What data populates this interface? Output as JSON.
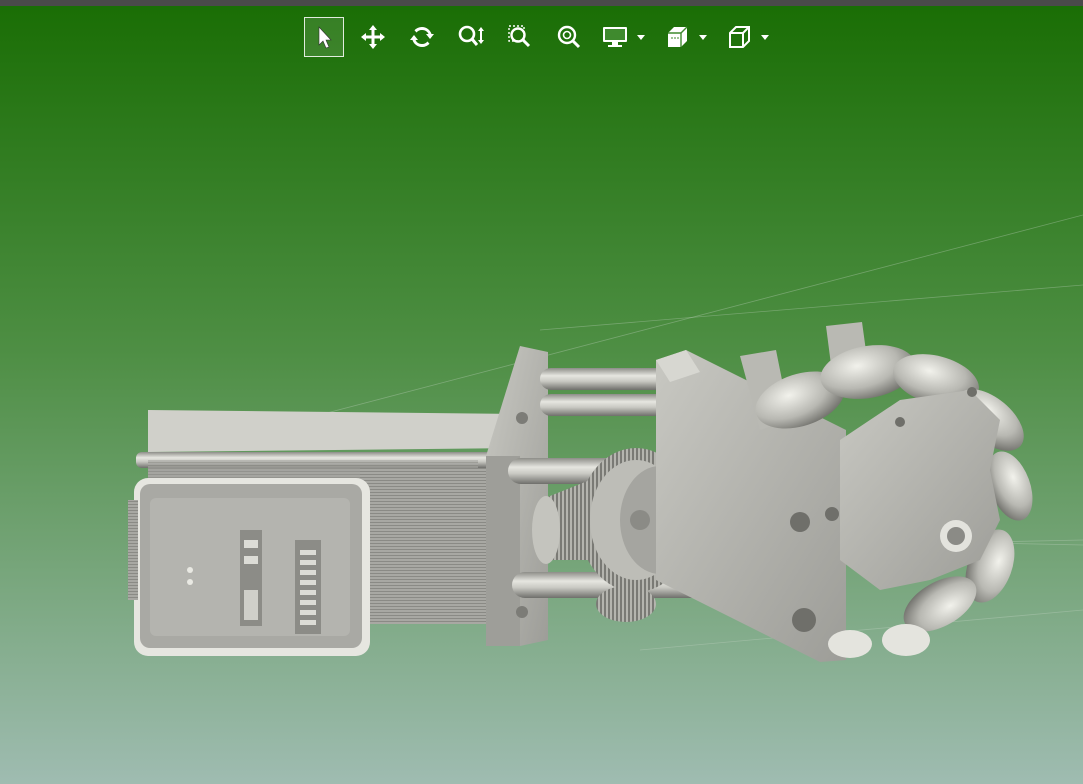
{
  "viewer": {
    "background_top": "#1a6e05",
    "background_bottom": "#9fbcb1",
    "top_strip": "#4a4a4a",
    "icon_color": "#ffffff",
    "part_color": "#b9b9b4"
  },
  "toolbar": {
    "tools": [
      {
        "name": "select-tool",
        "icon": "pointer-arrow-icon",
        "active": true
      },
      {
        "name": "pan-tool",
        "icon": "move-arrows-icon",
        "active": false
      },
      {
        "name": "rotate-tool",
        "icon": "rotate-arrows-icon",
        "active": false
      },
      {
        "name": "zoom-tool",
        "icon": "zoom-updown-icon",
        "active": false
      },
      {
        "name": "zoom-window-tool",
        "icon": "zoom-window-icon",
        "active": false
      },
      {
        "name": "zoom-fit-tool",
        "icon": "zoom-fit-icon",
        "active": false
      },
      {
        "name": "display-mode-tool",
        "icon": "monitor-icon",
        "active": false,
        "has_dropdown": true
      },
      {
        "name": "section-tool",
        "icon": "section-cube-icon",
        "active": false,
        "has_dropdown": true
      },
      {
        "name": "view-orientation-tool",
        "icon": "cube-icon",
        "active": false,
        "has_dropdown": true
      }
    ]
  }
}
